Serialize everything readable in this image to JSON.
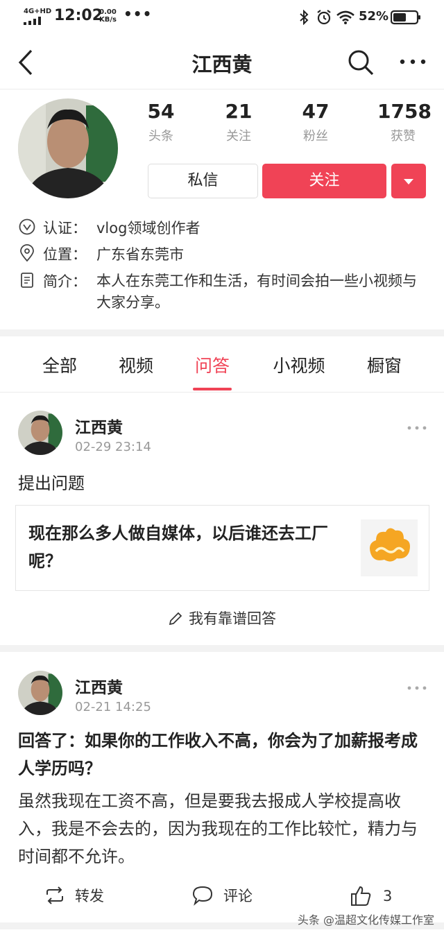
{
  "status_bar": {
    "network": "4G+HD",
    "time": "12:02",
    "speed_value": "0.00",
    "speed_unit": "KB/s",
    "dots": "•••",
    "battery": "52%"
  },
  "header": {
    "title": "江西黄"
  },
  "profile": {
    "stats": [
      {
        "value": "54",
        "label": "头条"
      },
      {
        "value": "21",
        "label": "关注"
      },
      {
        "value": "47",
        "label": "粉丝"
      },
      {
        "value": "1758",
        "label": "获赞"
      }
    ],
    "message_label": "私信",
    "follow_label": "关注",
    "verify_key": "认证：",
    "verify_value": "vlog领域创作者",
    "location_key": "位置：",
    "location_value": "广东省东莞市",
    "bio_key": "简介：",
    "bio_value": "本人在东莞工作和生活，有时间会拍一些小视频与大家分享。"
  },
  "tabs": [
    "全部",
    "视频",
    "问答",
    "小视频",
    "橱窗"
  ],
  "active_tab": "问答",
  "posts": [
    {
      "author": "江西黄",
      "time": "02-29 23:14",
      "action": "提出问题",
      "question": "现在那么多人做自媒体，以后谁还去工厂呢？",
      "answer_cta": "我有靠谱回答"
    },
    {
      "author": "江西黄",
      "time": "02-21 14:25",
      "title": "回答了：如果你的工作收入不高，你会为了加薪报考成人学历吗？",
      "body": "虽然我现在工资不高，但是要我去报成人学校提高收入，我是不会去的，因为我现在的工作比较忙，精力与时间都不允许。",
      "repost_label": "转发",
      "comment_label": "评论",
      "likes": "3"
    }
  ],
  "watermark": "头条 @温超文化传媒工作室",
  "colors": {
    "accent": "#f04356",
    "muted": "#999999"
  }
}
